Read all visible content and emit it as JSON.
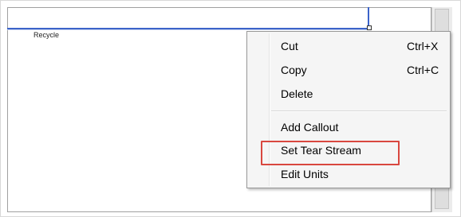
{
  "canvas": {
    "stream_label": "Recycle"
  },
  "context_menu": {
    "items": [
      {
        "label": "Cut",
        "shortcut": "Ctrl+X"
      },
      {
        "label": "Copy",
        "shortcut": "Ctrl+C"
      },
      {
        "label": "Delete",
        "shortcut": ""
      },
      {
        "label": "Add Callout",
        "shortcut": ""
      },
      {
        "label": "Set Tear Stream",
        "shortcut": ""
      },
      {
        "label": "Edit Units",
        "shortcut": ""
      }
    ]
  },
  "colors": {
    "stream_line": "#3b63c9",
    "highlight_border": "#d9473f",
    "menu_background": "#f5f5f5"
  }
}
